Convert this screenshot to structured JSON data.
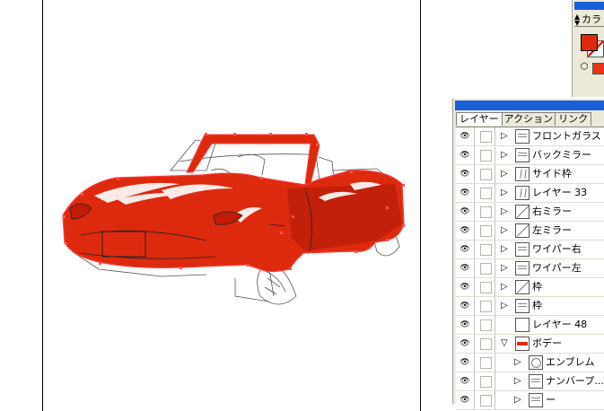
{
  "color_panel": {
    "tab_label": "カラ",
    "fill_color": "#dd2a0f",
    "icon": "cube-icon"
  },
  "layers_panel": {
    "tabs": [
      "レイヤー",
      "アクション",
      "リンク"
    ],
    "active_tab": "レイヤー",
    "layers": [
      {
        "name": "フロントガラス",
        "indent": 0,
        "expander": "collapsed",
        "thumb": "lines"
      },
      {
        "name": "バックミラー",
        "indent": 0,
        "expander": "collapsed",
        "thumb": "lines"
      },
      {
        "name": "サイド枠",
        "indent": 0,
        "expander": "collapsed",
        "thumb": "peak"
      },
      {
        "name": "レイヤー 33",
        "indent": 0,
        "expander": "collapsed",
        "thumb": "peak"
      },
      {
        "name": "右ミラー",
        "indent": 0,
        "expander": "collapsed",
        "thumb": "diag"
      },
      {
        "name": "左ミラー",
        "indent": 0,
        "expander": "collapsed",
        "thumb": "diag"
      },
      {
        "name": "ワイパー右",
        "indent": 0,
        "expander": "collapsed",
        "thumb": "lines"
      },
      {
        "name": "ワイパー左",
        "indent": 0,
        "expander": "collapsed",
        "thumb": "lines"
      },
      {
        "name": "枠",
        "indent": 0,
        "expander": "collapsed",
        "thumb": "diag"
      },
      {
        "name": "枠",
        "indent": 0,
        "expander": "collapsed",
        "thumb": "lines"
      },
      {
        "name": "レイヤー 48",
        "indent": 0,
        "expander": "none",
        "thumb": "blank"
      },
      {
        "name": "ボデー",
        "indent": 0,
        "expander": "expanded",
        "thumb": "red"
      },
      {
        "name": "エンブレム",
        "indent": 1,
        "expander": "collapsed",
        "thumb": "circle"
      },
      {
        "name": "ナンバープ...",
        "indent": 1,
        "expander": "collapsed",
        "thumb": "lines"
      },
      {
        "name": "ー",
        "indent": 1,
        "expander": "collapsed",
        "thumb": "lines"
      }
    ]
  },
  "canvas": {
    "body_color": "#dd2a0f",
    "selection_color": "#ff4040"
  }
}
